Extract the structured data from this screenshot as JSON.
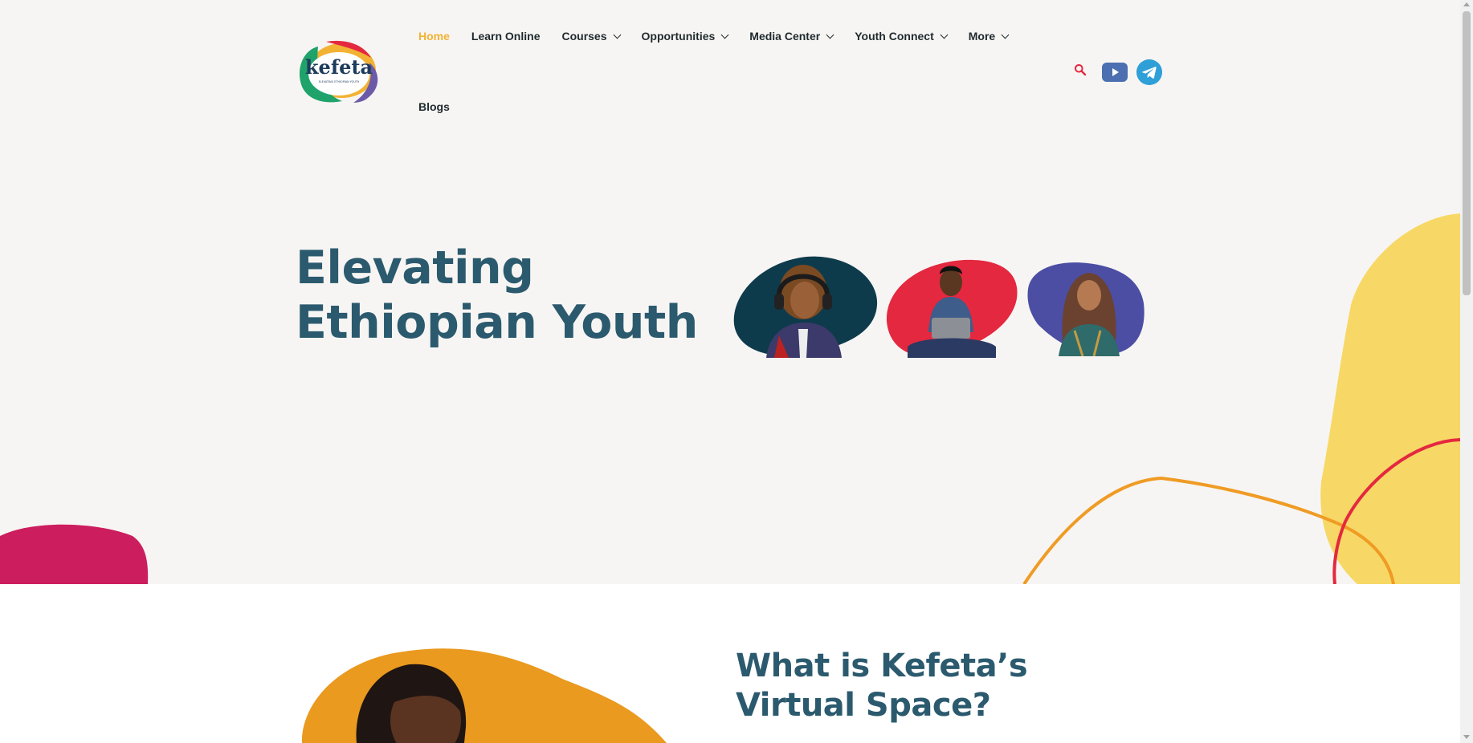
{
  "brand": {
    "logo_text": "kefeta",
    "logo_tagline": "ELEVATING ETHIOPIAN YOUTH"
  },
  "nav": {
    "items": [
      {
        "label": "Home",
        "active": true,
        "has_dropdown": false
      },
      {
        "label": "Learn Online",
        "active": false,
        "has_dropdown": false
      },
      {
        "label": "Courses",
        "active": false,
        "has_dropdown": true
      },
      {
        "label": "Opportunities",
        "active": false,
        "has_dropdown": true
      },
      {
        "label": "Media Center",
        "active": false,
        "has_dropdown": true
      },
      {
        "label": "Youth Connect",
        "active": false,
        "has_dropdown": true
      },
      {
        "label": "More",
        "active": false,
        "has_dropdown": true
      },
      {
        "label": "Blogs",
        "active": false,
        "has_dropdown": false
      }
    ]
  },
  "header_icons": [
    "search-icon",
    "youtube-icon",
    "telegram-icon"
  ],
  "hero": {
    "title_line1": "Elevating",
    "title_line2": "Ethiopian Youth"
  },
  "section2": {
    "title": "What is Kefeta’s Virtual Space?"
  },
  "colors": {
    "accent_yellow": "#f2b233",
    "heading_teal": "#2b5a6e",
    "brand_red": "#e4283f",
    "brand_purple": "#4b4ea3",
    "brand_dark_teal": "#0e3b4c",
    "brand_pink": "#cc1d5e",
    "brand_orange": "#e99a1f",
    "soft_yellow": "#f7d866",
    "search_red": "#e4283f",
    "youtube_blue": "#4b6fb0",
    "telegram_blue": "#2f9fd8"
  }
}
